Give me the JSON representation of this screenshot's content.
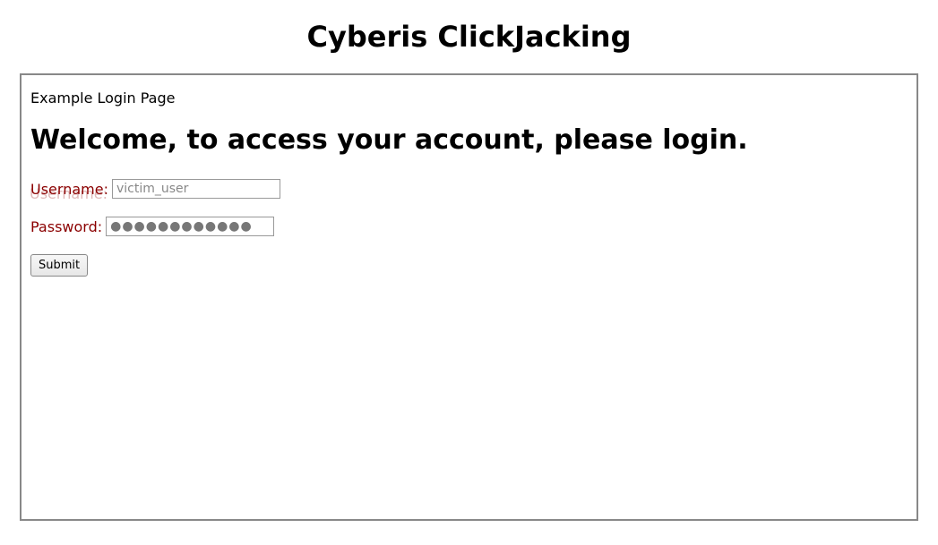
{
  "page": {
    "main_heading": "Cyberis ClickJacking"
  },
  "frame": {
    "title": "Example Login Page",
    "welcome_heading": "Welcome, to access your account, please login."
  },
  "form": {
    "username_label": "Username:",
    "username_value": "victim_user",
    "password_label": "Password:",
    "password_value": "●●●●●●●●●●●●",
    "submit_label": "Submit"
  },
  "ghost": {
    "overlap_text": "Username:"
  }
}
